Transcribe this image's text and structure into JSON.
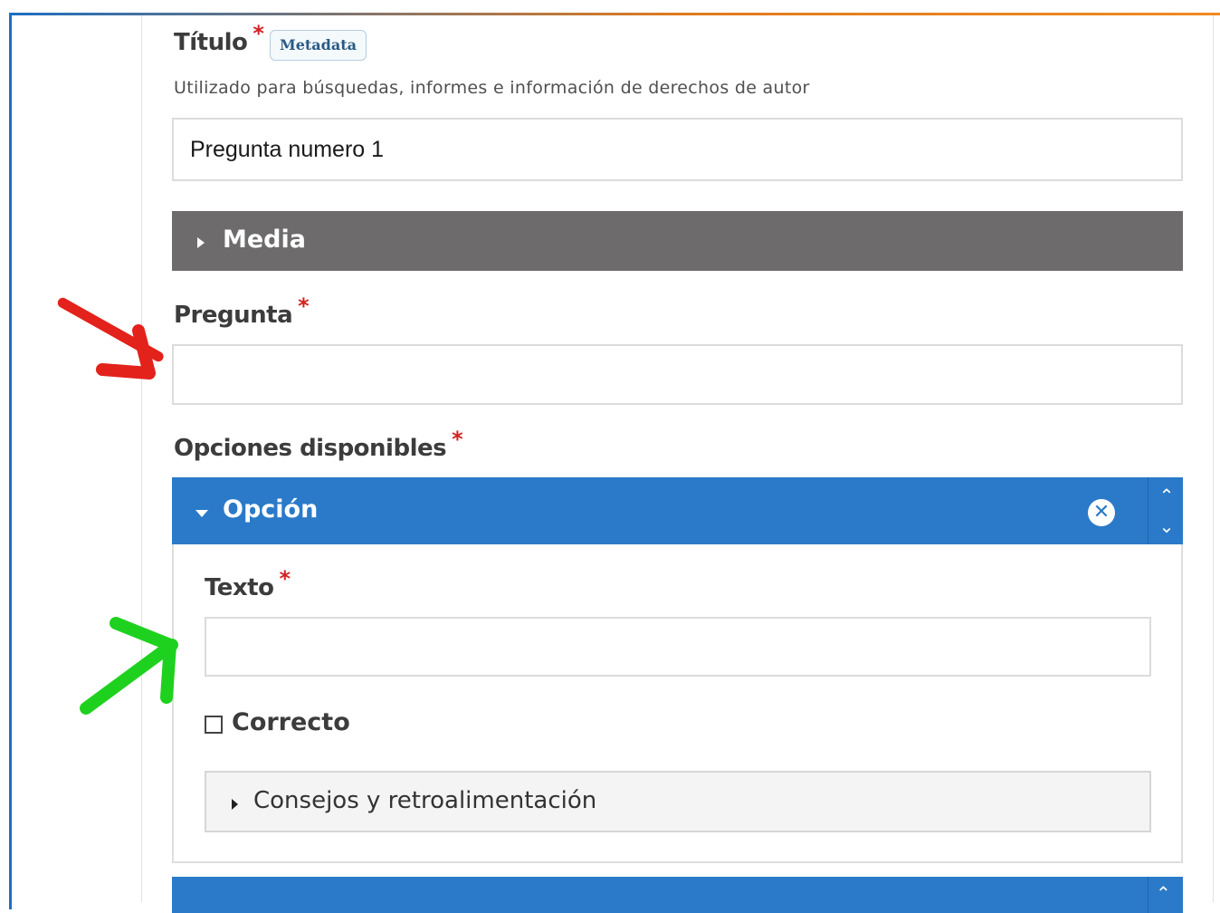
{
  "titulo": {
    "label": "Título",
    "required": "*",
    "badge": "Metadata",
    "description": "Utilizado para búsquedas, informes e información de derechos de autor",
    "value": "Pregunta numero 1"
  },
  "media": {
    "label": "Media"
  },
  "pregunta": {
    "label": "Pregunta",
    "required": "*",
    "value": ""
  },
  "opciones": {
    "label": "Opciones disponibles",
    "required": "*",
    "option": {
      "header": "Opción",
      "remove_icon": "circle-x-icon",
      "texto": {
        "label": "Texto",
        "required": "*",
        "value": ""
      },
      "correcto": {
        "label": "Correcto",
        "checked": false
      },
      "consejos": {
        "label": "Consejos y retroalimentación"
      }
    }
  },
  "annotations": {
    "red_arrow_color": "#e3221c",
    "green_arrow_color": "#1fd11f"
  },
  "colors": {
    "accent_blue": "#2a7ac9",
    "media_bar": "#6d6b6c",
    "required_star": "#d42222"
  }
}
